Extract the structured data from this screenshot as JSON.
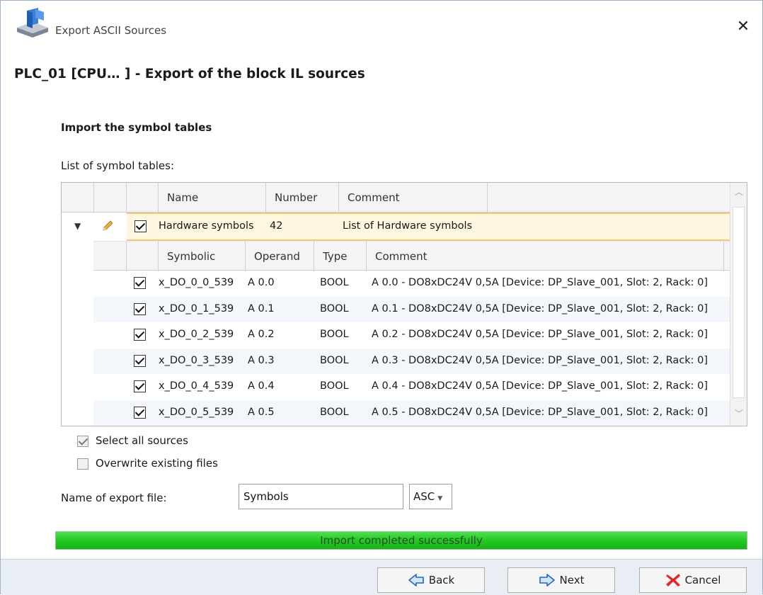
{
  "window": {
    "title": "Export ASCII Sources",
    "close_symbol": "✕"
  },
  "header": {
    "title": "PLC_01 [CPU… ]  - Export of the block IL sources"
  },
  "section": {
    "title": "Import the symbol tables",
    "list_label": "List of symbol tables:"
  },
  "table": {
    "columns": [
      "Name",
      "Number",
      "Comment"
    ],
    "parent": {
      "name": "Hardware symbols",
      "number": "42",
      "comment": "List of Hardware symbols",
      "checked": true
    },
    "sub_columns": [
      "Symbolic",
      "Operand",
      "Type",
      "Comment"
    ],
    "rows": [
      {
        "symbolic": "x_DO_0_0_539",
        "operand": "A 0.0",
        "type": "BOOL",
        "comment": "A 0.0 - DO8xDC24V 0,5A [Device: DP_Slave_001, Slot: 2, Rack: 0]",
        "checked": true
      },
      {
        "symbolic": "x_DO_0_1_539",
        "operand": "A 0.1",
        "type": "BOOL",
        "comment": "A 0.1 - DO8xDC24V 0,5A [Device: DP_Slave_001, Slot: 2, Rack: 0]",
        "checked": true
      },
      {
        "symbolic": "x_DO_0_2_539",
        "operand": "A 0.2",
        "type": "BOOL",
        "comment": "A 0.2 - DO8xDC24V 0,5A [Device: DP_Slave_001, Slot: 2, Rack: 0]",
        "checked": true
      },
      {
        "symbolic": "x_DO_0_3_539",
        "operand": "A 0.3",
        "type": "BOOL",
        "comment": "A 0.3 - DO8xDC24V 0,5A [Device: DP_Slave_001, Slot: 2, Rack: 0]",
        "checked": true
      },
      {
        "symbolic": "x_DO_0_4_539",
        "operand": "A 0.4",
        "type": "BOOL",
        "comment": "A 0.4 - DO8xDC24V 0,5A [Device: DP_Slave_001, Slot: 2, Rack: 0]",
        "checked": true
      },
      {
        "symbolic": "x_DO_0_5_539",
        "operand": "A 0.5",
        "type": "BOOL",
        "comment": "A 0.5 - DO8xDC24V 0,5A [Device: DP_Slave_001, Slot: 2, Rack: 0]",
        "checked": true
      }
    ]
  },
  "options": {
    "select_all": "Select all sources",
    "overwrite": "Overwrite existing files"
  },
  "export": {
    "label": "Name of export file:",
    "filename": "Symbols",
    "extension": "ASC"
  },
  "progress": {
    "text": "Import completed successfully",
    "percent": 100
  },
  "buttons": {
    "back": "Back",
    "next": "Next",
    "cancel": "Cancel"
  },
  "icons": {
    "app": "plc-export-icon",
    "expander": "triangle-down-icon",
    "edit": "pencil-icon",
    "back": "arrow-left-icon",
    "next": "arrow-right-icon",
    "cancel": "red-x-icon"
  },
  "colors": {
    "accent_progress": "#22c922",
    "selected_row_border": "#f5c77c",
    "footer_bg": "#e9eef5"
  }
}
